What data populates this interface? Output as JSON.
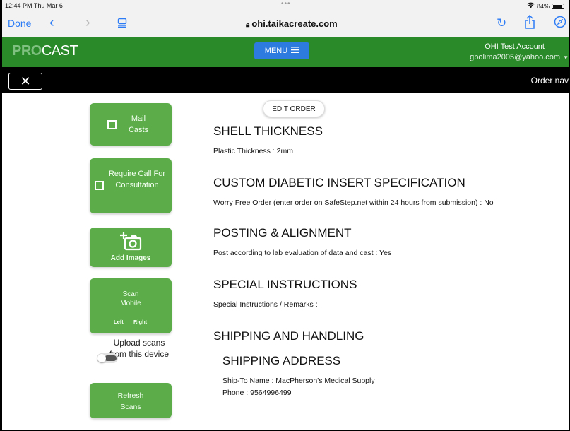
{
  "status_bar": {
    "time": "12:44 PM  Thu Mar 6",
    "dots": "•••",
    "battery": "84%"
  },
  "browser": {
    "done": "Done",
    "url": "ohi.taikacreate.com"
  },
  "site_header": {
    "logo_pro": "PRO",
    "logo_cast": "CAST",
    "menu_label": "MENU",
    "account_name": "OHI Test Account",
    "account_email": "gbolima2005@yahoo.com"
  },
  "order_nav": {
    "close": "✕",
    "title": "Order nav"
  },
  "sidebar": {
    "mail_casts": "Mail Casts",
    "require_call": "Require Call For Consultation",
    "add_images": "Add Images",
    "scan_mobile_1": "Scan",
    "scan_mobile_2": "Mobile",
    "scan_left": "Left",
    "scan_right": "Right",
    "upload_text": "Upload scans from this device",
    "upload_enabled": false,
    "refresh_1": "Refresh",
    "refresh_2": "Scans"
  },
  "order": {
    "edit_button": "EDIT ORDER",
    "sections": [
      {
        "heading": "SHELL THICKNESS",
        "line": "Plastic Thickness :  2mm"
      },
      {
        "heading": "CUSTOM DIABETIC INSERT SPECIFICATION",
        "line": "Worry Free Order (enter order on SafeStep.net within 24 hours from submission) :  No"
      },
      {
        "heading": "POSTING & ALIGNMENT",
        "line": "Post according to lab evaluation of data and cast :  Yes"
      },
      {
        "heading": "SPECIAL INSTRUCTIONS",
        "line": "Special Instructions / Remarks  :"
      },
      {
        "heading": "SHIPPING AND HANDLING",
        "line": ""
      }
    ],
    "shipping_address": {
      "heading": "SHIPPING ADDRESS",
      "ship_to": "Ship-To Name :  MacPherson's Medical Supply",
      "phone": "Phone :  9564996499"
    }
  },
  "colors": {
    "header_green": "#2a8a2a",
    "button_green": "#5cad4a",
    "menu_blue": "#2e7be0",
    "link_blue": "#2d7cf6"
  }
}
